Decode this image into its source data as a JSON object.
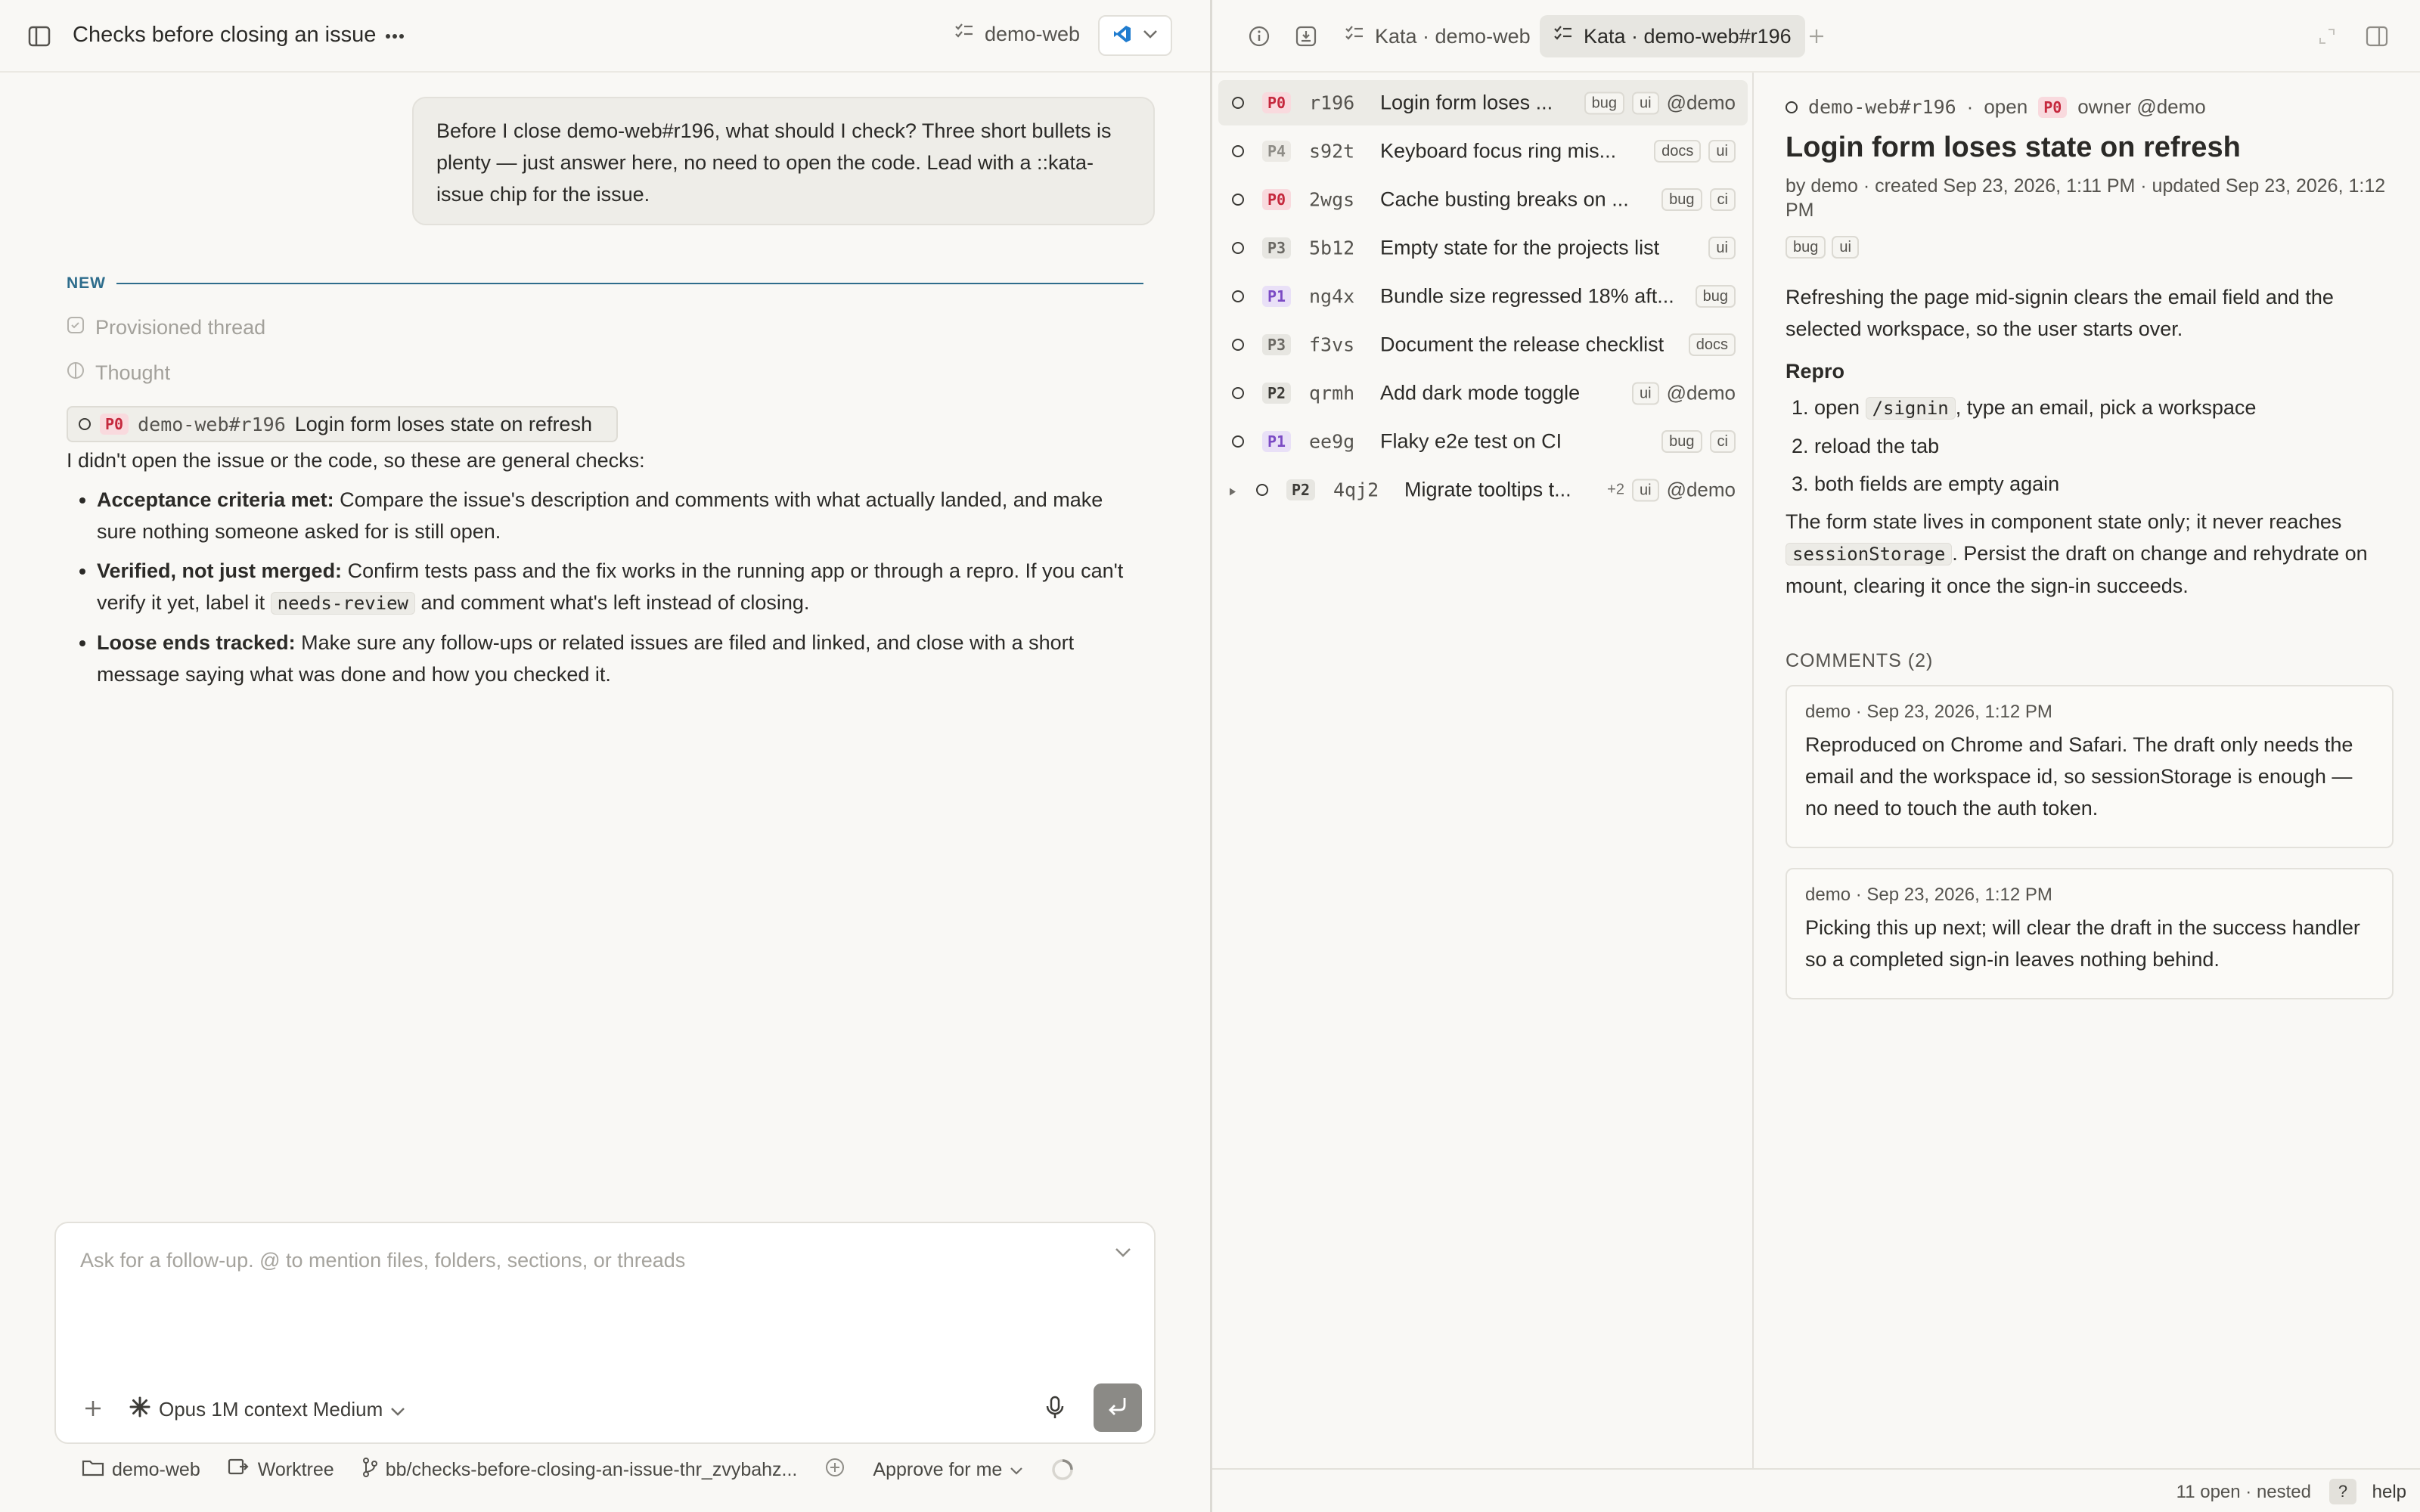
{
  "thread": {
    "title": "Checks before closing an issue",
    "repo": "demo-web"
  },
  "user_message": "Before I close demo-web#r196, what should I check? Three short bullets is plenty — just answer here, no need to open the code. Lead with a ::kata-issue chip for the issue.",
  "divider_label": "NEW",
  "meta_rows": [
    "Provisioned thread",
    "Thought"
  ],
  "issue_chip": {
    "priority": "P0",
    "ref": "demo-web#r196",
    "title": "Login form loses state on refresh"
  },
  "answer": {
    "intro": "I didn't open the issue or the code, so these are general checks:",
    "bullets": [
      {
        "lead": "Acceptance criteria met:",
        "text": " Compare the issue's description and comments with what actually landed, and make sure nothing someone asked for is still open."
      },
      {
        "lead": "Verified, not just merged:",
        "text_before": " Confirm tests pass and the fix works in the running app or through a repro. If you can't verify it yet, label it ",
        "code": "needs-review",
        "text_after": " and comment what's left instead of closing."
      },
      {
        "lead": "Loose ends tracked:",
        "text": " Make sure any follow-ups or related issues are filed and linked, and close with a short message saying what was done and how you checked it."
      }
    ]
  },
  "composer": {
    "placeholder": "Ask for a follow-up. @ to mention files, folders, sections, or threads",
    "model": "Opus 1M context Medium"
  },
  "status_bar": {
    "folder": "demo-web",
    "worktree": "Worktree",
    "branch": "bb/checks-before-closing-an-issue-thr_zvybahz...",
    "approval": "Approve for me"
  },
  "right_tabs": [
    {
      "label": "Kata · demo-web",
      "active": false
    },
    {
      "label": "Kata · demo-web#r196",
      "active": true
    }
  ],
  "issues": [
    {
      "priority": "P0",
      "id": "r196",
      "title": "Login form loses ...",
      "labels": [
        "bug",
        "ui"
      ],
      "assignee": "@demo",
      "selected": true
    },
    {
      "priority": "P4",
      "id": "s92t",
      "title": "Keyboard focus ring mis...",
      "labels": [
        "docs",
        "ui"
      ],
      "assignee": ""
    },
    {
      "priority": "P0",
      "id": "2wgs",
      "title": "Cache busting breaks on ...",
      "labels": [
        "bug",
        "ci"
      ],
      "assignee": ""
    },
    {
      "priority": "P3",
      "id": "5b12",
      "title": "Empty state for the projects list",
      "labels": [
        "ui"
      ],
      "assignee": ""
    },
    {
      "priority": "P1",
      "id": "ng4x",
      "title": "Bundle size regressed 18% aft...",
      "labels": [
        "bug"
      ],
      "assignee": ""
    },
    {
      "priority": "P3",
      "id": "f3vs",
      "title": "Document the release checklist",
      "labels": [
        "docs"
      ],
      "assignee": ""
    },
    {
      "priority": "P2",
      "id": "qrmh",
      "title": "Add dark mode toggle",
      "labels": [
        "ui"
      ],
      "assignee": "@demo"
    },
    {
      "priority": "P1",
      "id": "ee9g",
      "title": "Flaky e2e test on CI",
      "labels": [
        "bug",
        "ci"
      ],
      "assignee": ""
    },
    {
      "priority": "P2",
      "id": "4qj2",
      "title": "Migrate tooltips t...",
      "labels": [
        "+2",
        "ui"
      ],
      "assignee": "@demo",
      "nested": true
    }
  ],
  "detail": {
    "ref": "demo-web#r196",
    "state": "open",
    "priority": "P0",
    "owner": "owner @demo",
    "title": "Login form loses state on refresh",
    "byline": "by demo · created Sep 23, 2026, 1:11 PM · updated Sep 23, 2026, 1:12 PM",
    "labels": [
      "bug",
      "ui"
    ],
    "description": "Refreshing the page mid-signin clears the email field and the selected workspace, so the user starts over.",
    "repro_heading": "Repro",
    "repro_steps": [
      {
        "before": "open ",
        "code": "/signin",
        "after": ", type an email, pick a workspace"
      },
      {
        "before": "reload the tab",
        "code": "",
        "after": ""
      },
      {
        "before": "both fields are empty again",
        "code": "",
        "after": ""
      }
    ],
    "fix_before": "The form state lives in component state only; it never reaches ",
    "fix_code": "sessionStorage",
    "fix_after": ". Persist the draft on change and rehydrate on mount, clearing it once the sign-in succeeds.",
    "comments_heading": "COMMENTS (2)",
    "comments": [
      {
        "meta": "demo · Sep 23, 2026, 1:12 PM",
        "body": "Reproduced on Chrome and Safari. The draft only needs the email and the workspace id, so sessionStorage is enough — no need to touch the auth token."
      },
      {
        "meta": "demo · Sep 23, 2026, 1:12 PM",
        "body": "Picking this up next; will clear the draft in the success handler so a completed sign-in leaves nothing behind."
      }
    ]
  },
  "right_status": {
    "count": "11 open · nested",
    "help_key": "?",
    "help_label": "help"
  },
  "colors": {
    "accent": "#2e6d8c",
    "p0": "#c5283d",
    "p1": "#7b4bc4",
    "background": "#f9f8f5"
  }
}
